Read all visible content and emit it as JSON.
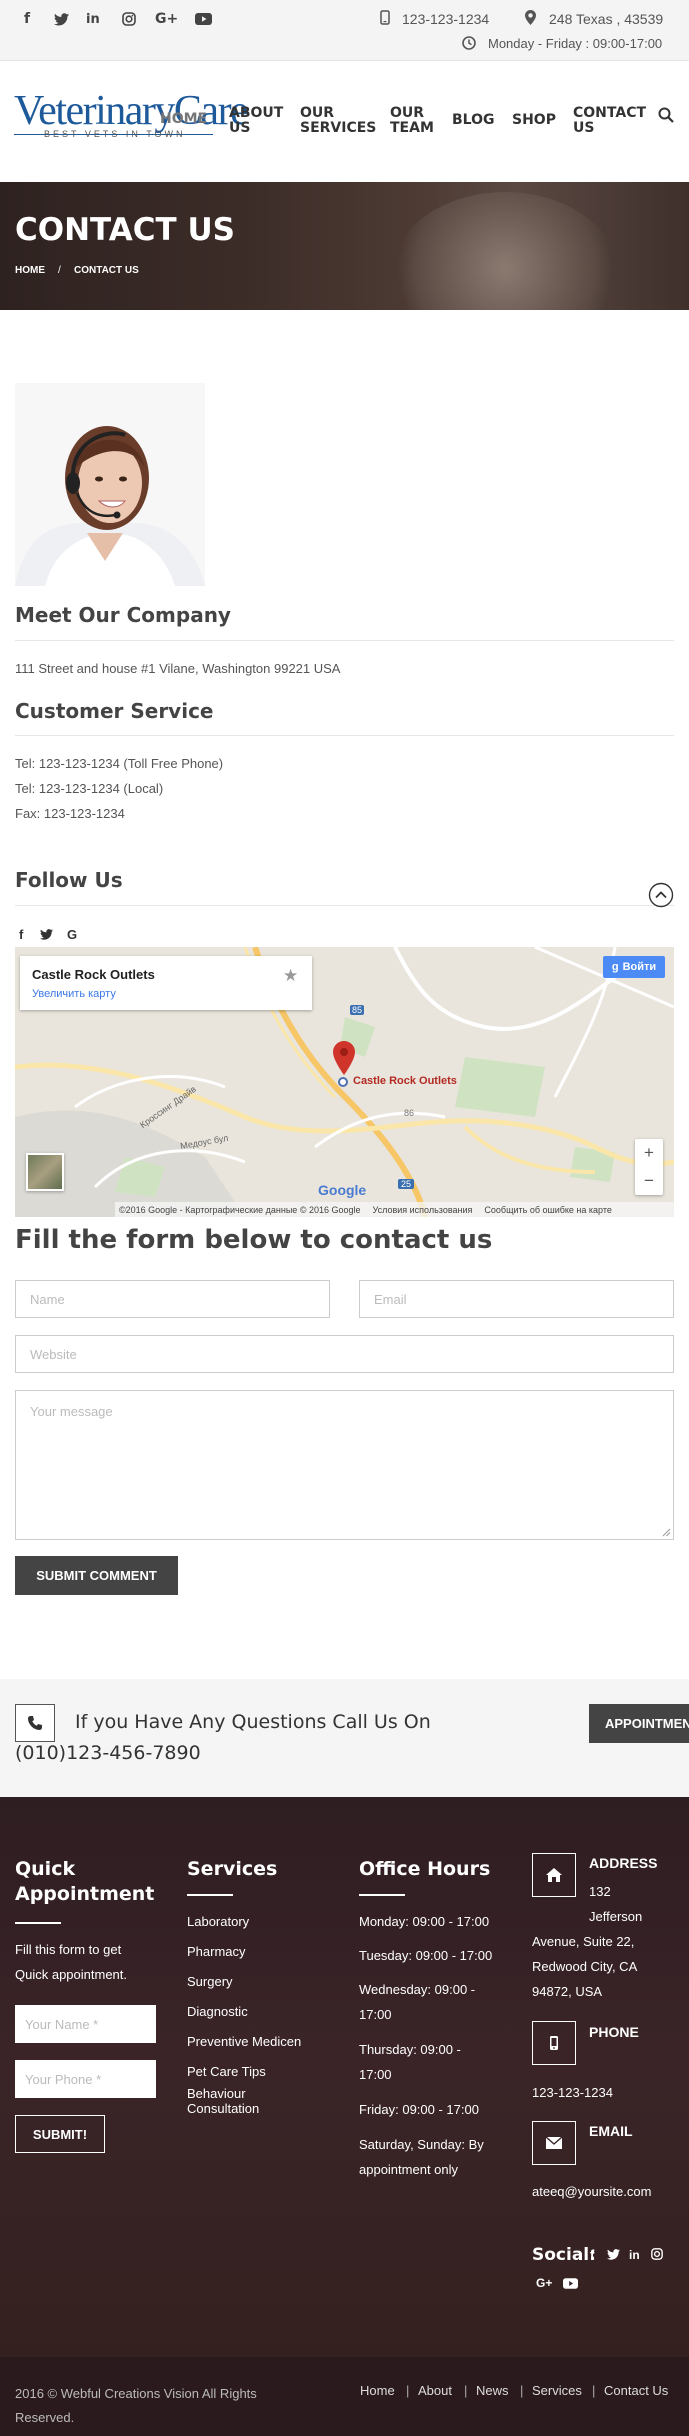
{
  "topbar": {
    "social_icons": [
      "facebook-icon",
      "twitter-icon",
      "linkedin-icon",
      "instagram-icon",
      "google-plus-icon",
      "youtube-icon"
    ],
    "phone": "123-123-1234",
    "address": "248 Texas , 43539",
    "hours": "Monday - Friday : 09:00-17:00"
  },
  "logo": {
    "name_part1": "Veterinary",
    "name_part2": "Care",
    "tagline": "BEST VETS IN TOWN"
  },
  "nav": {
    "home": "HOME",
    "about": "ABOUT US",
    "services": "OUR SERVICES",
    "team": "OUR TEAM",
    "blog": "BLOG",
    "shop": "SHOP",
    "contact": "CONTACT US"
  },
  "hero": {
    "title": "CONTACT US",
    "crumb_home": "HOME",
    "crumb_sep": "/",
    "crumb_current": "CONTACT US"
  },
  "company": {
    "heading": "Meet Our Company",
    "address": "111 Street and house #1 Vilane, Washington 99221 USA",
    "service_heading": "Customer Service",
    "tel_free": "Tel: 123-123-1234 (Toll Free Phone)",
    "tel_local": "Tel: 123-123-1234 (Local)",
    "fax": "Fax: 123-123-1234",
    "follow_heading": "Follow Us"
  },
  "map": {
    "card_title": "Castle Rock Outlets",
    "card_link": "Увеличить карту",
    "signin": "Войти",
    "pin_label": "Castle Rock Outlets",
    "logo": "Google",
    "footer_copy": "©2016 Google - Картографические данные © 2016 Google",
    "footer_terms": "Условия использования",
    "footer_report": "Сообщить об ошибке на карте",
    "street1": "Кроссинг Драйв",
    "street2": "Медоус бул",
    "zoom_in": "+",
    "zoom_out": "−",
    "road_85": "85",
    "road_86": "86",
    "road_25": "25"
  },
  "form": {
    "heading": "Fill the form below to contact us",
    "name_placeholder": "Name",
    "email_placeholder": "Email",
    "website_placeholder": "Website",
    "message_placeholder": "Your message",
    "submit_label": "SUBMIT COMMENT"
  },
  "callbar": {
    "line1": "If you Have Any Questions Call Us On",
    "line2": "(010)123-456-7890",
    "button": "APPOINTMENT"
  },
  "footer": {
    "qa_heading_1": "Quick",
    "qa_heading_2": "Appointment",
    "qa_text_1": "Fill this form to get",
    "qa_text_2": "Quick appointment.",
    "qa_name_placeholder": "Your Name *",
    "qa_phone_placeholder": "Your Phone *",
    "qa_submit": "SUBMIT!",
    "services_heading": "Services",
    "services": [
      "Laboratory",
      "Pharmacy",
      "Surgery",
      "Diagnostic",
      "Preventive Medicen",
      "Pet Care Tips",
      "Behaviour",
      "Consultation"
    ],
    "hours_heading": "Office Hours",
    "hours": [
      "Monday: 09:00 - 17:00",
      "Tuesday: 09:00 - 17:00",
      "Wednesday: 09:00 -",
      "17:00",
      "Thursday: 09:00 -",
      "17:00",
      "Friday: 09:00 - 17:00",
      "Saturday, Sunday: By",
      "appointment only"
    ],
    "address_heading": "ADDRESS",
    "address_lines": [
      "132",
      "Jefferson",
      "Avenue, Suite 22,",
      "Redwood City, CA",
      "94872, USA"
    ],
    "phone_heading": "PHONE",
    "phone": "123-123-1234",
    "email_heading": "EMAIL",
    "email": "ateeq@yoursite.com",
    "social_label": "Social:"
  },
  "bottom": {
    "copyright_1": "2016 © Webful Creations Vision All Rights",
    "copyright_2": "Reserved.",
    "links": [
      "Home",
      "About",
      "News",
      "Services",
      "Contact Us"
    ]
  },
  "colors": {
    "brand_blue": "#1e5a9a",
    "dark_button": "#444444",
    "footer_bg": "#36222a",
    "map_blue": "#4285f4",
    "pin_red": "#d0352b"
  }
}
